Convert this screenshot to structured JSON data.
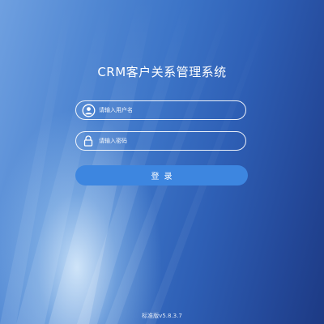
{
  "login": {
    "title": "CRM客户关系管理系统",
    "username": {
      "placeholder": "请输入用户名",
      "icon": "user-icon",
      "value": ""
    },
    "password": {
      "placeholder": "请输入密码",
      "icon": "lock-icon",
      "value": ""
    },
    "submit_label": "登录",
    "version": "标准版v5.8.3.7"
  },
  "colors": {
    "background_light": "#6fa0e0",
    "background_dark": "#1d3a84",
    "button": "#3d86e0",
    "text": "#ffffff"
  }
}
